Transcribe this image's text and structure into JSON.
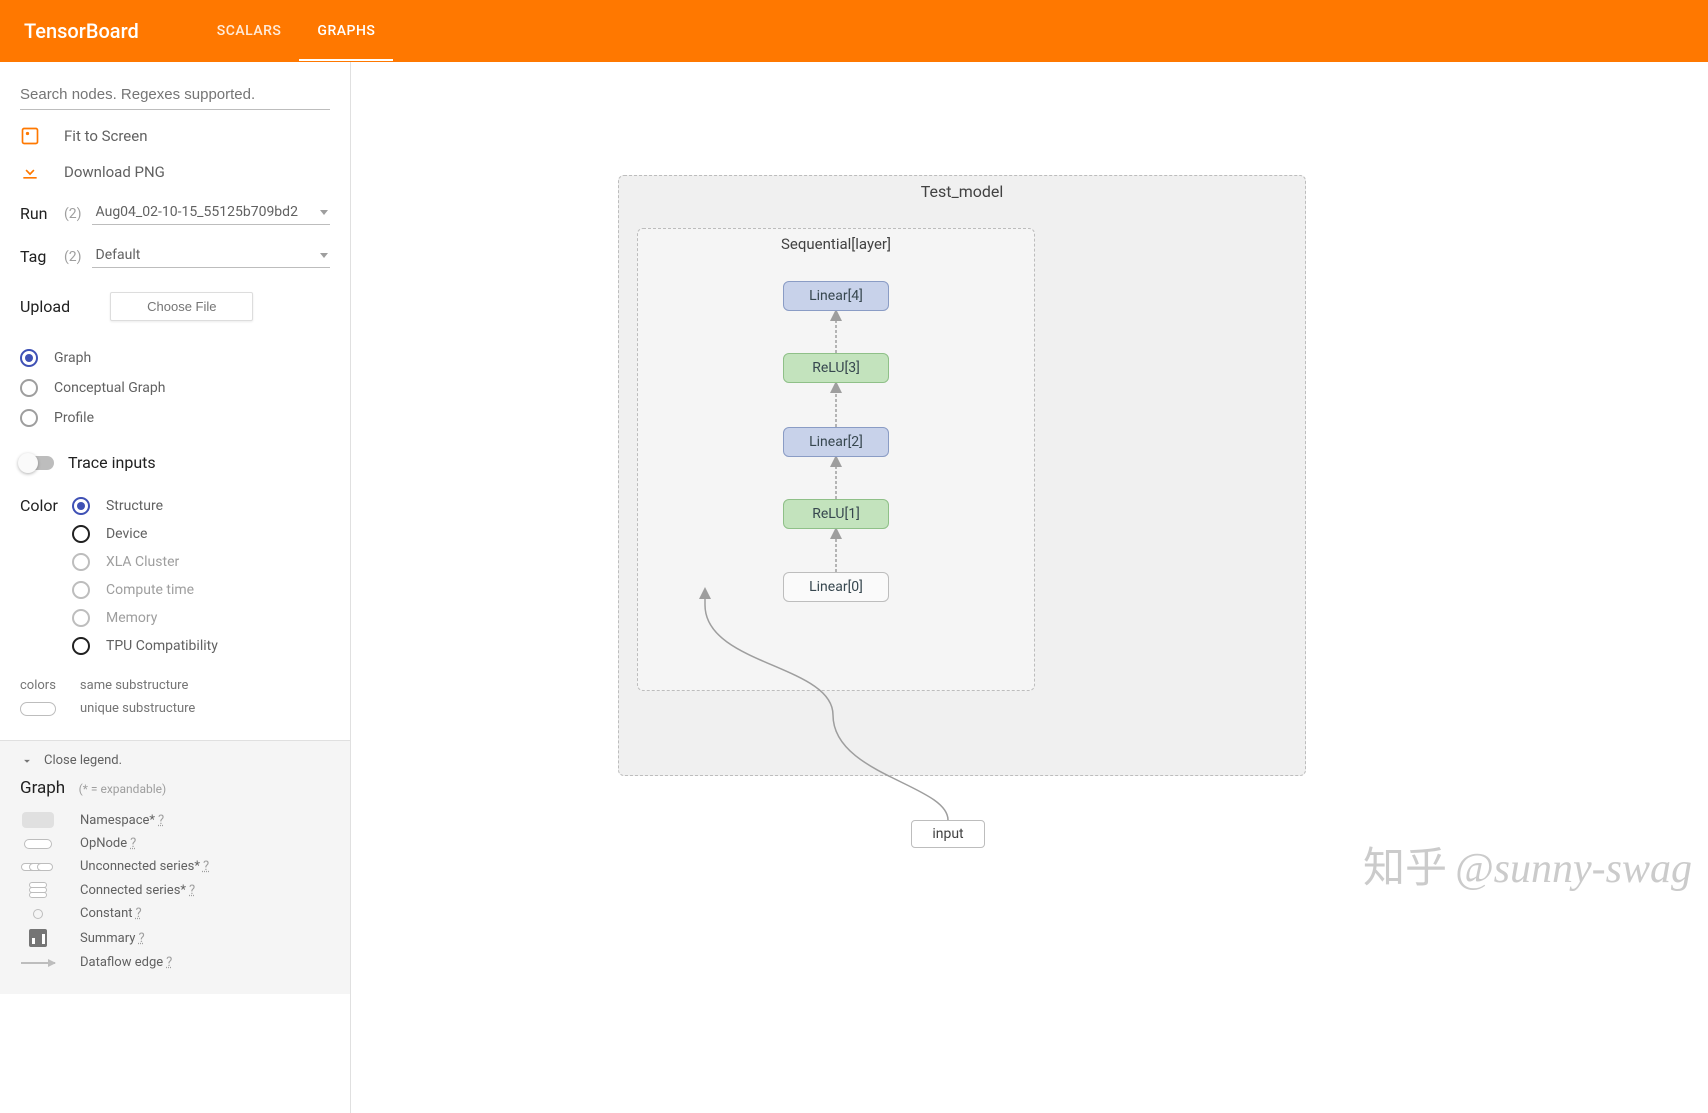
{
  "header": {
    "title": "TensorBoard",
    "tabs": [
      {
        "label": "SCALARS",
        "active": false
      },
      {
        "label": "GRAPHS",
        "active": true
      }
    ]
  },
  "sidebar": {
    "search_placeholder": "Search nodes. Regexes supported.",
    "fit_label": "Fit to Screen",
    "download_label": "Download PNG",
    "run": {
      "label": "Run",
      "count": "(2)",
      "value": "Aug04_02-10-15_55125b709bd2"
    },
    "tag": {
      "label": "Tag",
      "count": "(2)",
      "value": "Default"
    },
    "upload": {
      "label": "Upload",
      "button": "Choose File"
    },
    "view_radios": {
      "graph": "Graph",
      "conceptual": "Conceptual Graph",
      "profile": "Profile"
    },
    "trace_label": "Trace inputs",
    "color": {
      "title": "Color",
      "structure": "Structure",
      "device": "Device",
      "xla": "XLA Cluster",
      "compute": "Compute time",
      "memory": "Memory",
      "tpu": "TPU Compatibility"
    },
    "colors_legend": {
      "title": "colors",
      "same": "same substructure",
      "unique": "unique substructure"
    }
  },
  "legend": {
    "close": "Close legend.",
    "title": "Graph",
    "sub": "(* = expandable)",
    "namespace": "Namespace*",
    "opnode": "OpNode",
    "unconnected": "Unconnected series*",
    "connected": "Connected series*",
    "constant": "Constant",
    "summary": "Summary",
    "dataflow": "Dataflow edge"
  },
  "graph": {
    "outer_title": "Test_model",
    "inner_title": "Sequential[layer]",
    "nodes": {
      "n4": "Linear[4]",
      "n3": "ReLU[3]",
      "n2": "Linear[2]",
      "n1": "ReLU[1]",
      "n0": "Linear[0]"
    },
    "input_label": "input"
  },
  "watermark": "@sunny-swag",
  "watermark_zh": "知乎"
}
